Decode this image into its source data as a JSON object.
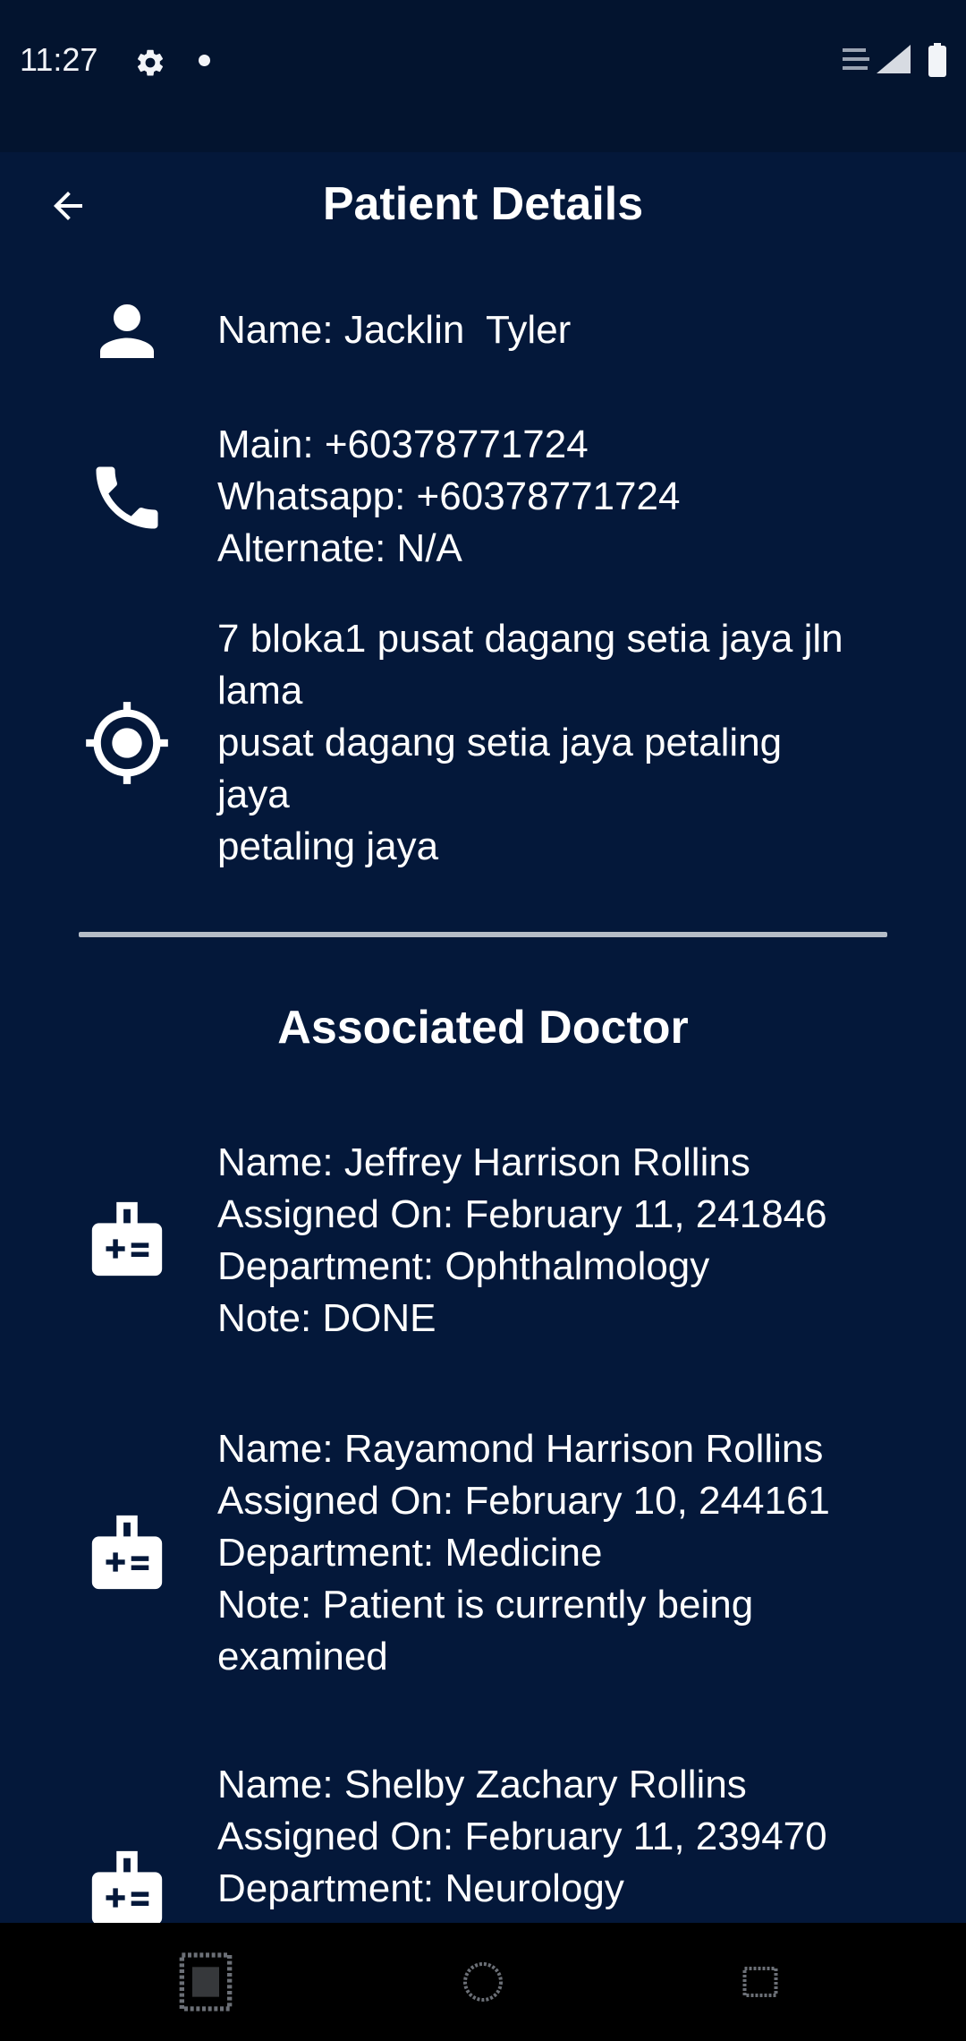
{
  "status_bar": {
    "time": "11:27",
    "icons": [
      "settings-gear-icon",
      "notification-dot-icon",
      "signal-icon",
      "battery-icon"
    ]
  },
  "app_bar": {
    "back_icon": "arrow-back-icon",
    "title": "Patient Details"
  },
  "patient": {
    "name_icon": "person-icon",
    "name": "Name: Jacklin  Tyler",
    "phone_icon": "phone-icon",
    "phones": [
      "Main: +60378771724",
      "Whatsapp: +60378771724",
      "Alternate: N/A"
    ],
    "address_icon": "location-target-icon",
    "address_lines": [
      "7 bloka1 pusat dagang setia jaya jln",
      "lama",
      "pusat dagang setia jaya petaling",
      "jaya",
      "petaling jaya"
    ]
  },
  "doctors_section": {
    "title": "Associated Doctor",
    "item_icon": "medical-id-badge-icon",
    "doctors": [
      {
        "name": "Name: Jeffrey Harrison Rollins",
        "assigned": "Assigned On: February 11, 241846",
        "department": "Department: Ophthalmology",
        "note": "Note: DONE"
      },
      {
        "name": "Name: Rayamond Harrison Rollins",
        "assigned": "Assigned On: February 10, 244161",
        "department": "Department: Medicine",
        "note": "Note: Patient is currently being\nexamined"
      },
      {
        "name": "Name: Shelby Zachary Rollins",
        "assigned": "Assigned On: February 11, 239470",
        "department": "Department: Neurology"
      }
    ]
  },
  "nav_bar": {
    "items": [
      "recent-apps-icon",
      "home-icon",
      "back-nav-icon"
    ]
  },
  "colors": {
    "background": "#04183a",
    "status_bar": "#03142f",
    "text": "#ffffff",
    "divider": "#b5bcc7",
    "nav_bar": "#000000"
  }
}
